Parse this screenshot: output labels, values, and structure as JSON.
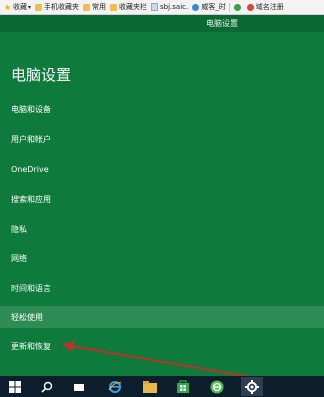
{
  "bookmarks": [
    {
      "label": "收藏",
      "icon": "star-icon",
      "has_dropdown": true
    },
    {
      "label": "手机收藏夹",
      "icon": "folder-icon"
    },
    {
      "label": "常用",
      "icon": "folder-icon"
    },
    {
      "label": "收藏夹栏",
      "icon": "folder-icon"
    },
    {
      "label": "sbj.saic.",
      "icon": "page-icon"
    },
    {
      "label": "威客_时",
      "icon": "web-icon"
    },
    {
      "label": "",
      "icon": "green-circle-icon"
    },
    {
      "label": "域名注册",
      "icon": "red-circle-icon"
    }
  ],
  "window": {
    "title": "电脑设置"
  },
  "settings": {
    "heading": "电脑设置",
    "items": [
      {
        "label": "电脑和设备"
      },
      {
        "label": "用户和帐户"
      },
      {
        "label": "OneDrive"
      },
      {
        "label": "搜索和应用"
      },
      {
        "label": "隐私"
      },
      {
        "label": "网络"
      },
      {
        "label": "时间和语言"
      },
      {
        "label": "轻松使用",
        "selected": true
      },
      {
        "label": "更新和恢复"
      }
    ]
  },
  "taskbar": {
    "items": [
      {
        "icon": "windows-start-icon"
      },
      {
        "icon": "search-icon"
      },
      {
        "icon": "task-view-icon"
      },
      {
        "icon": "internet-explorer-icon"
      },
      {
        "icon": "file-explorer-icon"
      },
      {
        "icon": "store-icon"
      },
      {
        "icon": "browser-icon"
      },
      {
        "icon": "settings-gear-icon",
        "active": true
      }
    ]
  },
  "colors": {
    "pane_bg": "#0e7a3c",
    "titlebar_bg": "#0b6a33",
    "selected_bg": "#2e8c55",
    "taskbar_bg": "#0c1e2c",
    "arrow": "#c0302a"
  }
}
